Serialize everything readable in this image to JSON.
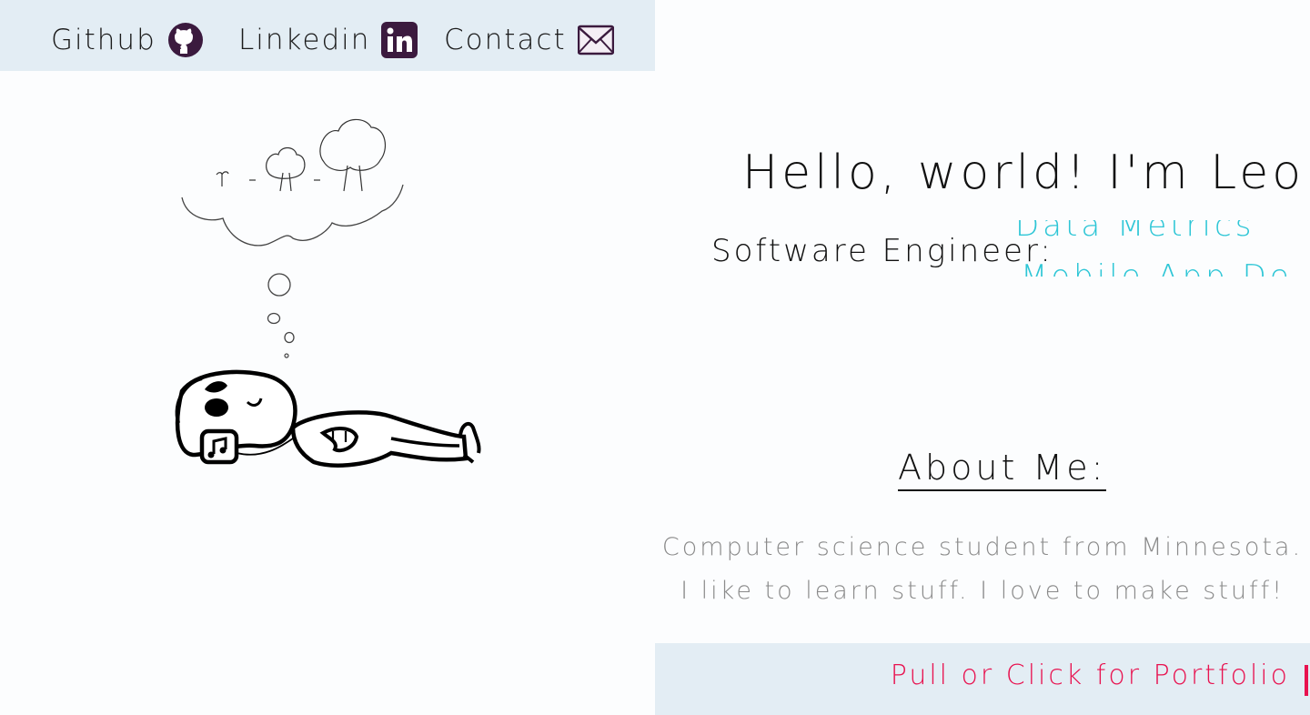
{
  "nav": {
    "items": [
      {
        "label": "Github",
        "icon": "github-icon"
      },
      {
        "label": "Linkedin",
        "icon": "linkedin-icon"
      },
      {
        "label": "Contact",
        "icon": "mail-icon"
      }
    ]
  },
  "hero": {
    "title": "Hello, world! I'm Leo",
    "role_label": "Software Engineer:",
    "roles": [
      "Data Metrics",
      "Mobile App De"
    ]
  },
  "about": {
    "title": "About Me:",
    "lines": [
      "Computer science student from Minnesota.",
      "I like to learn stuff. I love to make stuff!"
    ]
  },
  "footer": {
    "portfolio_label": "Pull or Click for Portfolio"
  },
  "colors": {
    "nav_bg": "#e3edf4",
    "accent_cyan": "#2ec6d6",
    "accent_pink": "#e8124f",
    "icon_dark": "#3b1a3e"
  }
}
